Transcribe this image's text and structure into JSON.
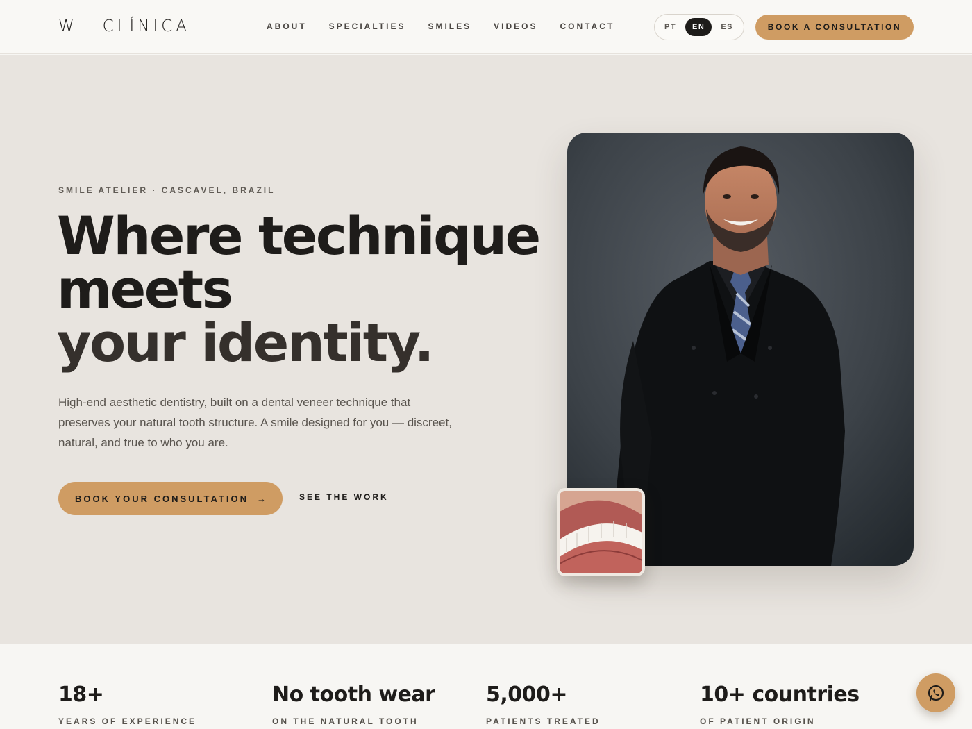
{
  "header": {
    "logo_left": "W",
    "logo_dot": "·",
    "logo_right": "CLÍNICA",
    "nav": [
      "ABOUT",
      "SPECIALTIES",
      "SMILES",
      "VIDEOS",
      "CONTACT"
    ],
    "languages": [
      "PT",
      "EN",
      "ES"
    ],
    "active_language": "EN",
    "cta": "BOOK A CONSULTATION"
  },
  "hero": {
    "eyebrow": "SMILE ATELIER · CASCAVEL, BRAZIL",
    "headline_1": "Where technique",
    "headline_2": "meets",
    "headline_3": "your identity.",
    "lede": "High-end aesthetic dentistry, built on a dental veneer technique that preserves your natural tooth structure. A smile designed for you — discreet, natural, and true to who you are.",
    "primary_cta": "BOOK YOUR CONSULTATION",
    "primary_cta_arrow": "→",
    "secondary_cta": "SEE THE WORK"
  },
  "stats": [
    {
      "value": "18+",
      "label": "YEARS OF EXPERIENCE"
    },
    {
      "value": "No tooth wear",
      "label": "ON THE NATURAL TOOTH"
    },
    {
      "value": "5,000+",
      "label": "PATIENTS TREATED"
    },
    {
      "value": "10+ countries",
      "label": "OF PATIENT ORIGIN"
    }
  ],
  "colors": {
    "accent": "#cf9c63",
    "hero_bg": "#e8e4df",
    "text": "#1e1c1a"
  },
  "icons": {
    "floating_button": "whatsapp-icon"
  }
}
